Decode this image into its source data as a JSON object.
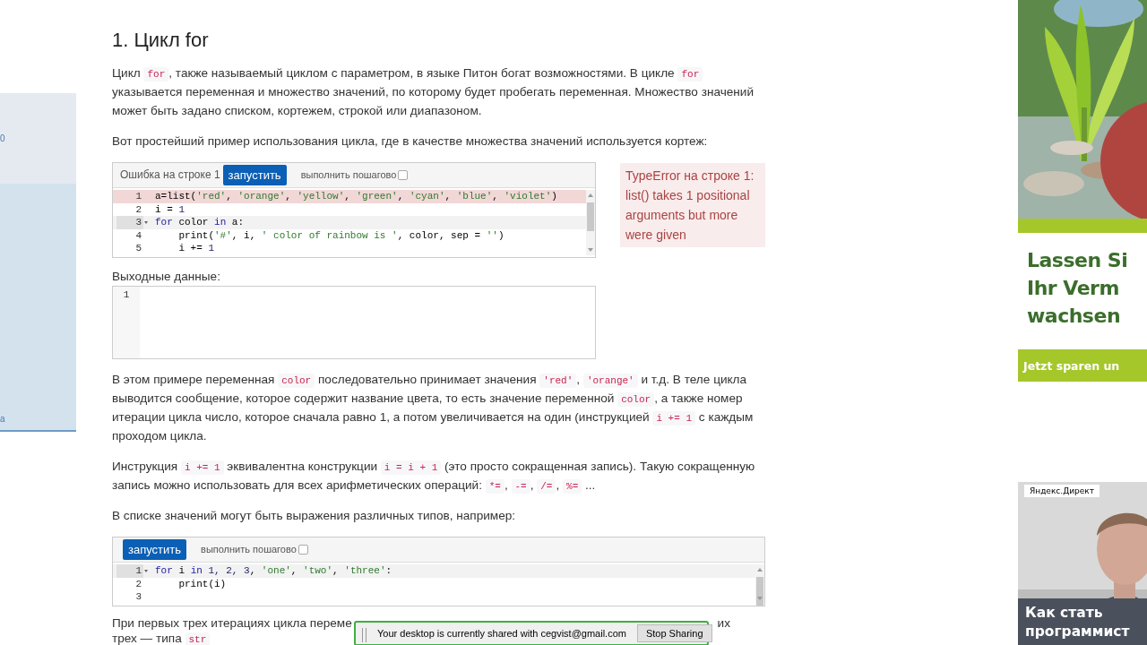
{
  "sidebar": {
    "texts": [
      "0",
      "а"
    ]
  },
  "content": [
    {
      "kind": "heading",
      "text": "1. Цикл for"
    },
    {
      "kind": "paragraph",
      "segments": [
        {
          "kind": "text",
          "text": "Цикл "
        },
        {
          "kind": "code",
          "text": "for"
        },
        {
          "kind": "text",
          "text": ", также называемый циклом с параметром, в языке Питон богат возможностями. В цикле "
        },
        {
          "kind": "code",
          "text": "for"
        },
        {
          "kind": "text",
          "text": " указывается переменная и множество значений, по которому будет пробегать переменная. Множество значений может быть задано списком, кортежем, строкой или диапазоном."
        }
      ]
    },
    {
      "kind": "paragraph",
      "segments": [
        {
          "kind": "text",
          "text": "Вот простейший пример использования цикла, где в качестве множества значений используется кортеж:"
        }
      ]
    },
    {
      "kind": "editor",
      "error_label": "Ошибка на строке 1",
      "run_button": "запустить",
      "step_toggle": {
        "label": "выполнить пошагово",
        "checked": false
      },
      "lines": [
        {
          "number": "1",
          "error": true,
          "current": false,
          "fold": false,
          "tokens": [
            {
              "kind": "plain",
              "text": "a=list("
            },
            {
              "kind": "str",
              "text": "'red'"
            },
            {
              "kind": "plain",
              "text": ", "
            },
            {
              "kind": "str",
              "text": "'orange'"
            },
            {
              "kind": "plain",
              "text": ", "
            },
            {
              "kind": "str",
              "text": "'yellow'"
            },
            {
              "kind": "plain",
              "text": ", "
            },
            {
              "kind": "str",
              "text": "'green'"
            },
            {
              "kind": "plain",
              "text": ", "
            },
            {
              "kind": "str",
              "text": "'cyan'"
            },
            {
              "kind": "plain",
              "text": ", "
            },
            {
              "kind": "str",
              "text": "'blue'"
            },
            {
              "kind": "plain",
              "text": ", "
            },
            {
              "kind": "str",
              "text": "'violet'"
            },
            {
              "kind": "plain",
              "text": ")"
            }
          ]
        },
        {
          "number": "2",
          "error": false,
          "current": false,
          "fold": false,
          "tokens": [
            {
              "kind": "plain",
              "text": "i = "
            },
            {
              "kind": "num",
              "text": "1"
            }
          ]
        },
        {
          "number": "3",
          "error": false,
          "current": true,
          "fold": true,
          "tokens": [
            {
              "kind": "kw",
              "text": "for"
            },
            {
              "kind": "plain",
              "text": " color "
            },
            {
              "kind": "kw",
              "text": "in"
            },
            {
              "kind": "plain",
              "text": " a:"
            }
          ]
        },
        {
          "number": "4",
          "error": false,
          "current": false,
          "fold": false,
          "tokens": [
            {
              "kind": "plain",
              "text": "    print("
            },
            {
              "kind": "str",
              "text": "'#'"
            },
            {
              "kind": "plain",
              "text": ", i, "
            },
            {
              "kind": "str",
              "text": "' color of rainbow is '"
            },
            {
              "kind": "plain",
              "text": ", color, sep = "
            },
            {
              "kind": "str",
              "text": "''"
            },
            {
              "kind": "plain",
              "text": ")"
            }
          ]
        },
        {
          "number": "5",
          "error": false,
          "current": false,
          "fold": false,
          "tokens": [
            {
              "kind": "plain",
              "text": "    i += "
            },
            {
              "kind": "num",
              "text": "1"
            }
          ]
        }
      ],
      "error_message": "TypeError на строке 1: list() takes 1 positional arguments but more were given"
    },
    {
      "kind": "output",
      "label": "Выходные данные:",
      "lines": [
        "1"
      ]
    },
    {
      "kind": "paragraph",
      "segments": [
        {
          "kind": "text",
          "text": "В этом примере переменная "
        },
        {
          "kind": "code",
          "text": "color"
        },
        {
          "kind": "text",
          "text": " последовательно принимает значения "
        },
        {
          "kind": "code",
          "text": "'red'"
        },
        {
          "kind": "text",
          "text": ", "
        },
        {
          "kind": "code",
          "text": "'orange'"
        },
        {
          "kind": "text",
          "text": " и т.д. В теле цикла выводится сообщение, которое содержит название цвета, то есть значение переменной "
        },
        {
          "kind": "code",
          "text": "color"
        },
        {
          "kind": "text",
          "text": ", а также номер итерации цикла  число, которое сначала равно 1, а потом увеличивается на один (инструкцией "
        },
        {
          "kind": "code",
          "text": "i += 1"
        },
        {
          "kind": "text",
          "text": " с каждым проходом цикла."
        }
      ]
    },
    {
      "kind": "paragraph",
      "segments": [
        {
          "kind": "text",
          "text": "Инструкция "
        },
        {
          "kind": "code",
          "text": "i += 1"
        },
        {
          "kind": "text",
          "text": " эквивалентна конструкции "
        },
        {
          "kind": "code",
          "text": "i = i + 1"
        },
        {
          "kind": "text",
          "text": " (это просто сокращенная запись). Такую сокращенную запись можно использовать для всех арифметических операций: "
        },
        {
          "kind": "code",
          "text": "*="
        },
        {
          "kind": "text",
          "text": ", "
        },
        {
          "kind": "code",
          "text": "-="
        },
        {
          "kind": "text",
          "text": ", "
        },
        {
          "kind": "code",
          "text": "/="
        },
        {
          "kind": "text",
          "text": ", "
        },
        {
          "kind": "code",
          "text": "%="
        },
        {
          "kind": "text",
          "text": " ..."
        }
      ]
    },
    {
      "kind": "paragraph",
      "segments": [
        {
          "kind": "text",
          "text": "В списке значений могут быть выражения различных типов, например:"
        }
      ]
    },
    {
      "kind": "editor",
      "run_button": "запустить",
      "step_toggle": {
        "label": "выполнить пошагово",
        "checked": false
      },
      "lines": [
        {
          "number": "1",
          "error": false,
          "current": true,
          "fold": true,
          "tokens": [
            {
              "kind": "kw",
              "text": "for"
            },
            {
              "kind": "plain",
              "text": " i "
            },
            {
              "kind": "kw",
              "text": "in"
            },
            {
              "kind": "num",
              "text": " 1, 2, 3"
            },
            {
              "kind": "plain",
              "text": ", "
            },
            {
              "kind": "str",
              "text": "'one'"
            },
            {
              "kind": "plain",
              "text": ", "
            },
            {
              "kind": "str",
              "text": "'two'"
            },
            {
              "kind": "plain",
              "text": ", "
            },
            {
              "kind": "str",
              "text": "'three'"
            },
            {
              "kind": "plain",
              "text": ":"
            }
          ]
        },
        {
          "number": "2",
          "error": false,
          "current": false,
          "fold": false,
          "tokens": [
            {
              "kind": "plain",
              "text": "    print(i)"
            }
          ]
        },
        {
          "number": "3",
          "error": false,
          "current": false,
          "fold": false
        }
      ]
    },
    {
      "kind": "cut_paragraph",
      "lines": [
        {
          "left": [
            {
              "kind": "text",
              "text": "При первых трех итерациях цикла переме"
            }
          ],
          "right": [
            {
              "kind": "text",
              "text": "их"
            }
          ]
        },
        {
          "left": [
            {
              "kind": "text",
              "text": "трех — типа "
            },
            {
              "kind": "code",
              "text": "str"
            }
          ]
        }
      ]
    }
  ],
  "ads": [
    {
      "kind": "banner",
      "headline": [
        "Lassen Si",
        "Ihr Verm",
        "wachsen"
      ],
      "button": "Jetzt sparen un"
    },
    {
      "kind": "direct",
      "label": "Яндекс.Директ",
      "caption": [
        "Как стать",
        "программист"
      ]
    }
  ],
  "share_bar": {
    "message": "Your desktop is currently shared with cegvist@gmail.com",
    "button": "Stop Sharing"
  }
}
